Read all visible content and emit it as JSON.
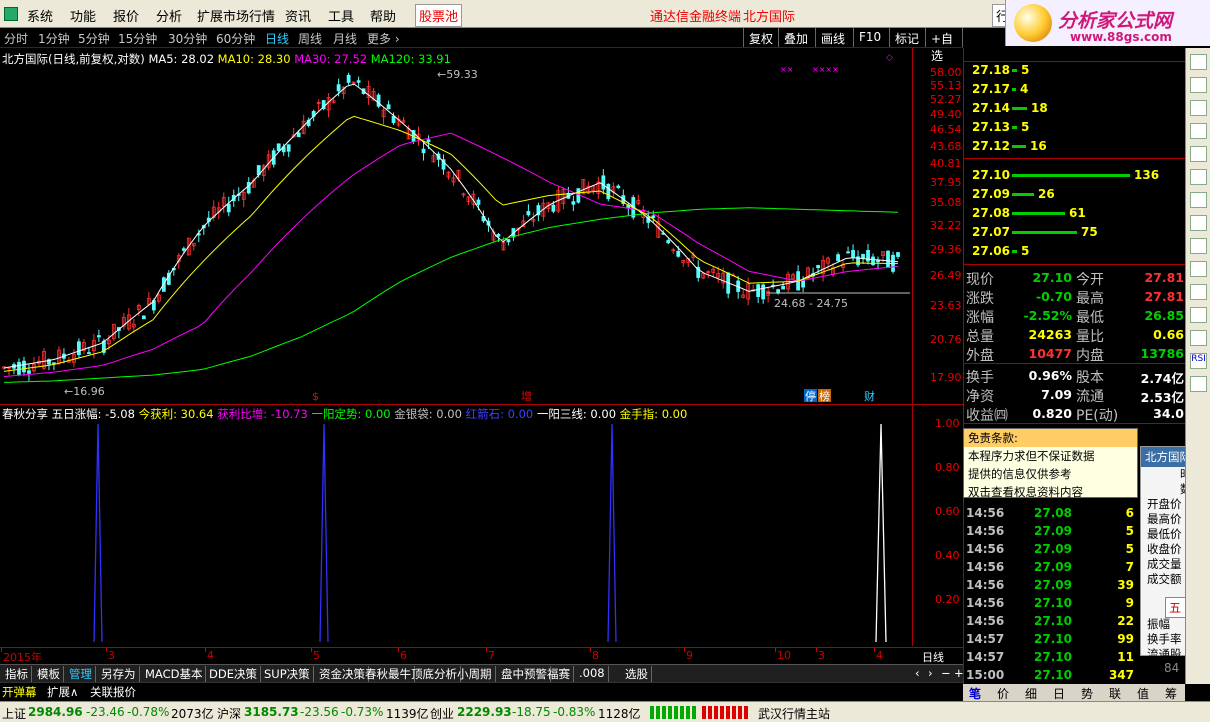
{
  "menu": {
    "items": [
      "系统",
      "功能",
      "报价",
      "分析",
      "扩展市场行情",
      "资讯",
      "工具",
      "帮助"
    ],
    "red_item": "股票池",
    "center_title": "通达信金融终端",
    "stock_name": "北方国际",
    "right_button": "行",
    "logo_title": "分析家公式网",
    "logo_url": "www.88gs.com"
  },
  "period_bar": {
    "items": [
      "分时",
      "1分钟",
      "5分钟",
      "15分钟",
      "30分钟",
      "60分钟",
      "日线",
      "周线",
      "月线",
      "更多 ›"
    ],
    "active": "日线",
    "buttons": [
      "复权",
      "叠加",
      "画线",
      "F10",
      "标记",
      "+自选"
    ]
  },
  "chart_legend": {
    "title": "北方国际(日线,前复权,对数)",
    "ma5": "MA5: 28.02",
    "ma10": "MA10: 28.30",
    "ma30": "MA30: 27.52",
    "ma120": "MA120: 33.91"
  },
  "price_axis": [
    "58.00",
    "55.13",
    "52.27",
    "49.40",
    "46.54",
    "43.68",
    "40.81",
    "37.95",
    "35.08",
    "32.22",
    "29.36",
    "26.49",
    "23.63",
    "20.76",
    "17.90"
  ],
  "chart_annotations": {
    "high_label": "59.33",
    "low_label": "16.96",
    "range_label": "24.68 - 24.75",
    "event_s": "$",
    "event_zeng": "增",
    "event_ting": "停",
    "event_bang": "榜",
    "event_cai": "财"
  },
  "chart_data": {
    "type": "line",
    "title": "北方国际(日线,前复权,对数)",
    "xlabel": "",
    "ylabel": "",
    "ylim": [
      17.9,
      58.0
    ],
    "x_months": [
      "2015年",
      "3",
      "4",
      "5",
      "6",
      "7",
      "8",
      "9",
      "10",
      "3",
      "4"
    ],
    "series": [
      {
        "name": "MA5",
        "values": [
          18.6,
          19.2,
          20.5,
          24.0,
          32.0,
          38.0,
          47.0,
          56.0,
          48.0,
          40.0,
          30.0,
          35.0,
          38.0,
          33.0,
          27.0,
          25.0,
          26.0,
          28.5,
          28.02
        ]
      },
      {
        "name": "MA30",
        "values": [
          18.0,
          18.3,
          18.8,
          20.0,
          22.0,
          27.0,
          33.0,
          39.0,
          44.0,
          46.0,
          42.0,
          38.0,
          35.0,
          34.0,
          30.0,
          27.0,
          26.0,
          27.0,
          27.52
        ]
      },
      {
        "name": "MA120",
        "values": [
          17.6,
          17.7,
          17.9,
          18.1,
          18.5,
          19.5,
          21.0,
          23.0,
          26.0,
          28.5,
          30.5,
          32.0,
          33.0,
          33.8,
          34.3,
          34.5,
          34.3,
          34.1,
          33.91
        ]
      }
    ],
    "key_points": {
      "high": 59.33,
      "low": 16.96,
      "range_low": 24.68,
      "range_high": 24.75,
      "last": 27.1
    }
  },
  "indicator": {
    "name": "春秋分享",
    "fields": [
      {
        "label": "五日涨幅:",
        "value": "-5.08",
        "color": "#ffffff"
      },
      {
        "label": "今获利:",
        "value": "30.64",
        "color": "#ffff00"
      },
      {
        "label": "获利比增:",
        "value": "-10.73",
        "color": "#ff00ff"
      },
      {
        "label": "一阳定势:",
        "value": "0.00",
        "color": "#00ff00"
      },
      {
        "label": "金银袋:",
        "value": "0.00",
        "color": "#c0c0c0"
      },
      {
        "label": "红箭石:",
        "value": "0.00",
        "color": "#4040ff"
      },
      {
        "label": "一阳三线:",
        "value": "0.00",
        "color": "#ffffff"
      },
      {
        "label": "金手指:",
        "value": "0.00",
        "color": "#ffff00"
      }
    ],
    "axis": [
      "1.00",
      "0.80",
      "0.60",
      "0.40",
      "0.20"
    ],
    "chart_data": {
      "type": "line",
      "ylim": [
        0,
        1.0
      ],
      "series": [
        {
          "name": "红箭石",
          "values": [
            1.0,
            1.0,
            1.0
          ]
        },
        {
          "name": "一阳三线",
          "values": [
            1.0
          ]
        }
      ]
    }
  },
  "date_axis": [
    "2015年",
    "3",
    "4",
    "5",
    "6",
    "7",
    "8",
    "9",
    "10",
    "3",
    "4"
  ],
  "date_axis_right": "日线",
  "bottom_tabs": [
    "指标",
    "模板",
    "管理",
    "另存为",
    "MACD基本",
    "DDE决策",
    "SUP决策",
    "资金决策",
    "春秋最牛",
    "顶底分析",
    "小周期",
    "盘中预警",
    "福赛",
    ".008",
    "选股"
  ],
  "bottom_tabs_active": "管理",
  "sub_tabs": [
    "开弹幕",
    "扩展∧",
    "关联报价"
  ],
  "orderbook": [
    {
      "price": "27.18",
      "vol": "5",
      "bar": 0.04
    },
    {
      "price": "27.17",
      "vol": "4",
      "bar": 0.03
    },
    {
      "price": "27.14",
      "vol": "18",
      "bar": 0.13
    },
    {
      "price": "27.13",
      "vol": "5",
      "bar": 0.04
    },
    {
      "price": "27.12",
      "vol": "16",
      "bar": 0.12
    },
    {
      "price": "27.10",
      "vol": "136",
      "bar": 1.0
    },
    {
      "price": "27.09",
      "vol": "26",
      "bar": 0.19
    },
    {
      "price": "27.08",
      "vol": "61",
      "bar": 0.45
    },
    {
      "price": "27.07",
      "vol": "75",
      "bar": 0.55
    },
    {
      "price": "27.06",
      "vol": "5",
      "bar": 0.04
    }
  ],
  "quote": [
    {
      "k1": "现价",
      "v1": "27.10",
      "c1": "#00d000",
      "k2": "今开",
      "v2": "27.81",
      "c2": "#ff3030"
    },
    {
      "k1": "涨跌",
      "v1": "-0.70",
      "c1": "#00d000",
      "k2": "最高",
      "v2": "27.81",
      "c2": "#ff3030"
    },
    {
      "k1": "涨幅",
      "v1": "-2.52%",
      "c1": "#00d000",
      "k2": "最低",
      "v2": "26.85",
      "c2": "#00d000"
    },
    {
      "k1": "总量",
      "v1": "24263",
      "c1": "#ffff00",
      "k2": "量比",
      "v2": "0.66",
      "c2": "#ffff00"
    },
    {
      "k1": "外盘",
      "v1": "10477",
      "c1": "#ff3030",
      "k2": "内盘",
      "v2": "13786",
      "c2": "#00d000"
    },
    {
      "k1": "换手",
      "v1": "0.96%",
      "c1": "#ffffff",
      "k2": "股本",
      "v2": "2.74亿",
      "c2": "#ffffff"
    },
    {
      "k1": "净资",
      "v1": "7.09",
      "c1": "#ffffff",
      "k2": "流通",
      "v2": "2.53亿",
      "c2": "#ffffff"
    },
    {
      "k1": "收益㈣",
      "v1": "0.820",
      "c1": "#ffffff",
      "k2": "PE(动)",
      "v2": "34.0",
      "c2": "#ffffff"
    }
  ],
  "ticks": [
    {
      "time": "14:56",
      "price": "",
      "vol": ""
    },
    {
      "time": "14:56",
      "price": "",
      "vol": ""
    },
    {
      "time": "14:56",
      "price": "",
      "vol": ""
    },
    {
      "time": "14:56",
      "price": "",
      "vol": ""
    },
    {
      "time": "14:56",
      "price": "27.08",
      "vol": "6"
    },
    {
      "time": "14:56",
      "price": "27.09",
      "vol": "5"
    },
    {
      "time": "14:56",
      "price": "27.09",
      "vol": "5"
    },
    {
      "time": "14:56",
      "price": "27.09",
      "vol": "7"
    },
    {
      "time": "14:56",
      "price": "27.09",
      "vol": "39"
    },
    {
      "time": "14:56",
      "price": "27.10",
      "vol": "9"
    },
    {
      "time": "14:56",
      "price": "27.10",
      "vol": "22"
    },
    {
      "time": "14:57",
      "price": "27.10",
      "vol": "99"
    },
    {
      "time": "14:57",
      "price": "27.10",
      "vol": "11"
    },
    {
      "time": "15:00",
      "price": "27.10",
      "vol": "347"
    }
  ],
  "popup": {
    "header": "免责条款:",
    "lines": [
      "本程序力求但不保证数据",
      "提供的信息仅供参考",
      "双击查看权息资料内容"
    ]
  },
  "info_panel": {
    "title": "北方国际",
    "items": [
      "时间",
      "数值",
      "开盘价",
      "最高价",
      "最低价",
      "收盘价",
      "成交量",
      "成交额",
      "",
      "",
      "振幅",
      "换手率",
      "流通股"
    ],
    "ime": "五 中"
  },
  "right_tabs": [
    "笔",
    "价",
    "细",
    "日",
    "势",
    "联",
    "值",
    "筹"
  ],
  "status": {
    "sh_label": "上证",
    "sh_val": "2984.96",
    "sh_chg": "-23.46",
    "sh_pct": "-0.78%",
    "sh_amt": "2073亿",
    "hs_label": "沪深",
    "hs_val": "3185.73",
    "hs_chg": "-23.56",
    "hs_pct": "-0.73%",
    "hs_amt": "1139亿",
    "cy_label": "创业",
    "cy_val": "2229.93",
    "cy_chg": "-18.75",
    "cy_pct": "-0.83%",
    "cy_amt": "1128亿",
    "host": "武汉行情主站"
  }
}
